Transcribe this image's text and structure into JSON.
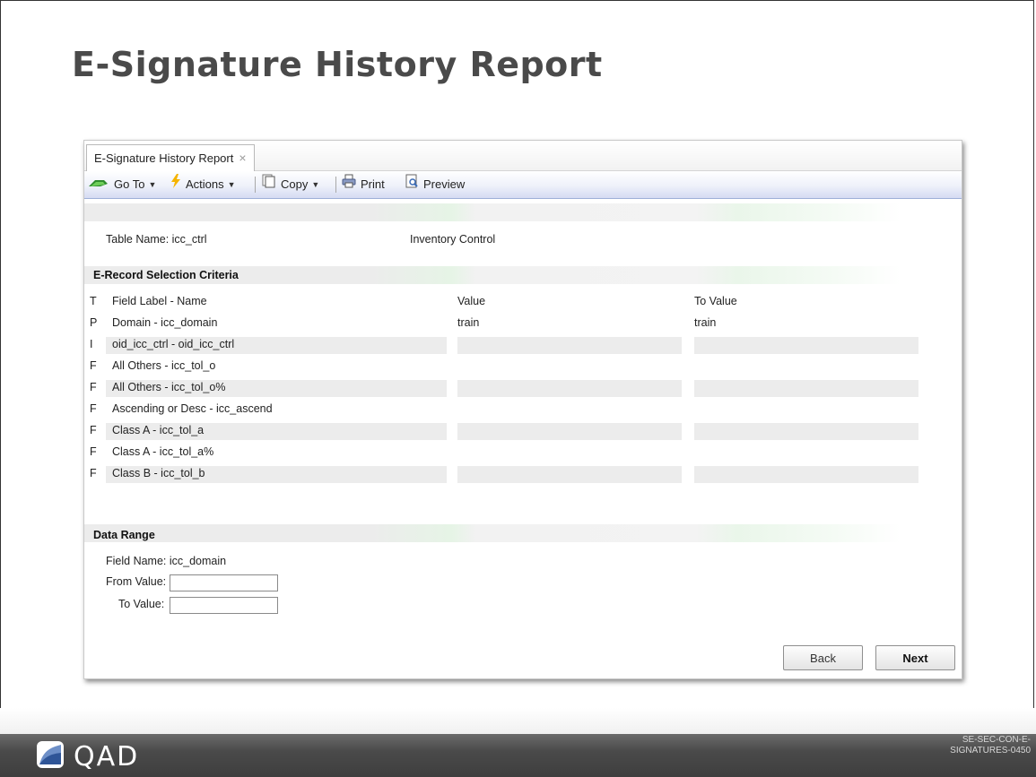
{
  "slide": {
    "title": "E-Signature History Report",
    "code": "SE-SEC-CON-E-SIGNATURES-0450"
  },
  "window": {
    "tab_label": "E-Signature History Report",
    "tab_close": "×",
    "toolbar": {
      "goto": "Go To",
      "actions": "Actions",
      "copy": "Copy",
      "print": "Print",
      "preview": "Preview"
    }
  },
  "table": {
    "name_label": "Table Name: icc_ctrl",
    "description": "Inventory Control"
  },
  "criteria": {
    "heading": "E-Record Selection Criteria",
    "headers": {
      "t": "T",
      "field": "Field Label - Name",
      "value": "Value",
      "to_value": "To Value"
    },
    "rows": [
      {
        "t": "P",
        "field": "Domain - icc_domain",
        "value": "train",
        "to_value": "train",
        "shaded": false
      },
      {
        "t": "I",
        "field": "oid_icc_ctrl - oid_icc_ctrl",
        "value": "",
        "to_value": "",
        "shaded": true
      },
      {
        "t": "F",
        "field": "All Others - icc_tol_o",
        "value": "",
        "to_value": "",
        "shaded": false
      },
      {
        "t": "F",
        "field": "All Others - icc_tol_o%",
        "value": "",
        "to_value": "",
        "shaded": true
      },
      {
        "t": "F",
        "field": "Ascending or Desc - icc_ascend",
        "value": "",
        "to_value": "",
        "shaded": false
      },
      {
        "t": "F",
        "field": "Class A - icc_tol_a",
        "value": "",
        "to_value": "",
        "shaded": true
      },
      {
        "t": "F",
        "field": "Class A - icc_tol_a%",
        "value": "",
        "to_value": "",
        "shaded": false
      },
      {
        "t": "F",
        "field": "Class B - icc_tol_b",
        "value": "",
        "to_value": "",
        "shaded": true
      }
    ]
  },
  "data_range": {
    "heading": "Data Range",
    "field_name": "Field Name: icc_domain",
    "from_label": "From Value:",
    "from_value": "",
    "to_label": "To Value:",
    "to_value": ""
  },
  "buttons": {
    "back": "Back",
    "next": "Next"
  },
  "logo": {
    "text": "QAD"
  }
}
